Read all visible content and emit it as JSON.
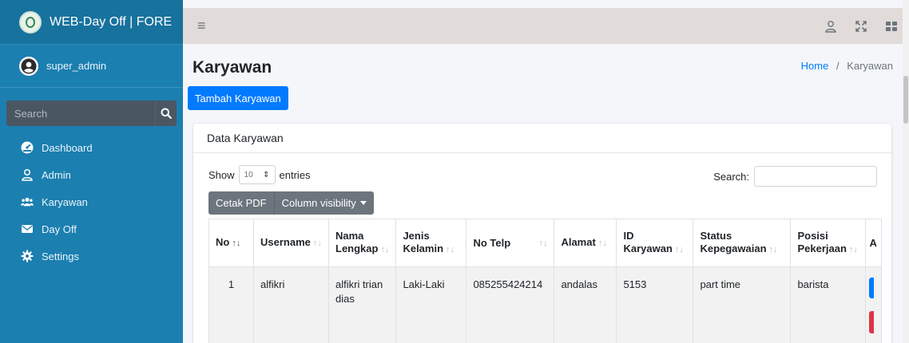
{
  "brand": {
    "title": "WEB-Day Off | FORE"
  },
  "user": {
    "name": "super_admin"
  },
  "sidebar_search": {
    "placeholder": "Search"
  },
  "nav": {
    "items": [
      {
        "label": "Dashboard",
        "icon": "tachometer-icon"
      },
      {
        "label": "Admin",
        "icon": "user-icon"
      },
      {
        "label": "Karyawan",
        "icon": "users-icon"
      },
      {
        "label": "Day Off",
        "icon": "envelope-icon"
      },
      {
        "label": "Settings",
        "icon": "gear-icon"
      }
    ]
  },
  "page": {
    "title": "Karyawan",
    "breadcrumb_home": "Home",
    "breadcrumb_sep": "/",
    "breadcrumb_current": "Karyawan",
    "add_button": "Tambah Karyawan"
  },
  "card": {
    "title": "Data Karyawan"
  },
  "controls": {
    "show": "Show",
    "entries_value": "10",
    "entries": "entries",
    "search_label": "Search:",
    "btn_pdf": "Cetak PDF",
    "btn_columns": "Column visibility"
  },
  "table": {
    "headers": [
      "No",
      "Username",
      "Nama Lengkap",
      "Jenis Kelamin",
      "No Telp",
      "Alamat",
      "ID Karyawan",
      "Status Kepegawaian",
      "Posisi Pekerjaan",
      "A"
    ],
    "rows": [
      [
        "1",
        "alfikri",
        "alfikri trian dias",
        "Laki-Laki",
        "085255424214",
        "andalas",
        "5153",
        "part time",
        "barista"
      ]
    ]
  },
  "colors": {
    "sidebar": "#1b7fb0",
    "primary": "#007bff",
    "danger": "#dc3545",
    "secondary": "#6c757d"
  }
}
